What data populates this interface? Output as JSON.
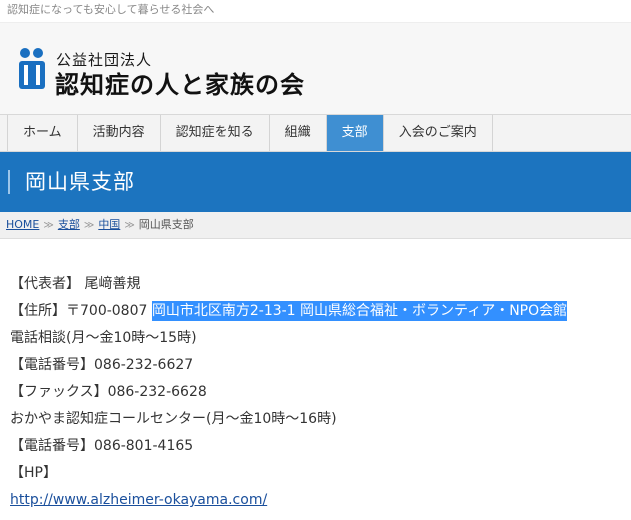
{
  "tagline": "認知症になっても安心して暮らせる社会へ",
  "logo": {
    "org_type": "公益社団法人",
    "org_name": "認知症の人と家族の会"
  },
  "nav": {
    "items": [
      {
        "label": "ホーム",
        "active": false
      },
      {
        "label": "活動内容",
        "active": false
      },
      {
        "label": "認知症を知る",
        "active": false
      },
      {
        "label": "組織",
        "active": false
      },
      {
        "label": "支部",
        "active": true
      },
      {
        "label": "入会のご案内",
        "active": false
      }
    ]
  },
  "page": {
    "title": "岡山県支部"
  },
  "breadcrumb": {
    "home": "HOME",
    "branch": "支部",
    "region": "中国",
    "current": "岡山県支部"
  },
  "content": {
    "representative": "【代表者】 尾﨑善規",
    "address_label": "【住所】〒700-0807",
    "address_selected": "岡山市北区南方2-13-1 岡山県総合福祉・ボランティア・NPO会館",
    "phone_consult": "電話相談(月～金10時～15時)",
    "phone1": "【電話番号】086-232-6627",
    "fax": "【ファックス】086-232-6628",
    "call_center": "おかやま認知症コールセンター(月～金10時～16時)",
    "phone2": "【電話番号】086-801-4165",
    "hp_label": "【HP】",
    "hp_url": "http://www.alzheimer-okayama.com/"
  },
  "colors": {
    "brand_blue": "#1c74bf",
    "nav_active": "#3f8fd2",
    "selection": "#3390ff"
  }
}
